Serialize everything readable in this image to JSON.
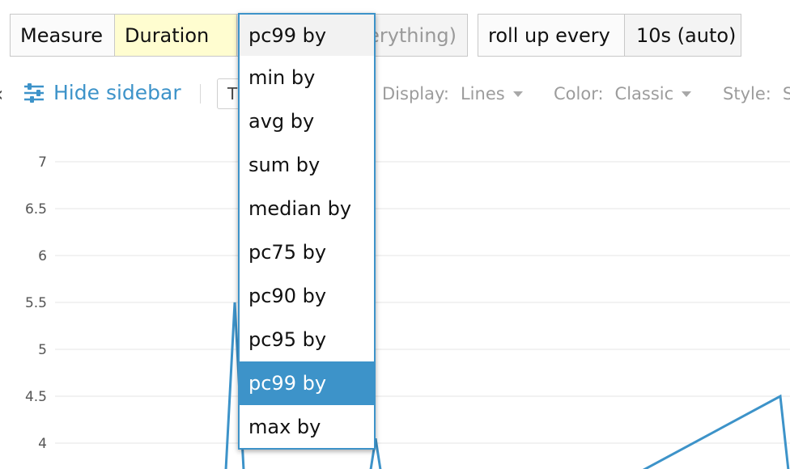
{
  "query": {
    "measure_label": "Measure",
    "metric": "Duration",
    "aggregation": "pc99 by",
    "group_by_placeholder": "erything)"
  },
  "rollup": {
    "label": "roll up every",
    "value": "10s (auto)"
  },
  "toolbar": {
    "hide_sidebar": "Hide sidebar",
    "input_text": "T",
    "display_label": "Display:",
    "display_value": "Lines",
    "color_label": "Color:",
    "color_value": "Classic",
    "style_label": "Style:",
    "style_value": "S"
  },
  "dropdown": {
    "current": "pc99 by",
    "options": [
      "min by",
      "avg by",
      "sum by",
      "median by",
      "pc75 by",
      "pc90 by",
      "pc95 by",
      "pc99 by",
      "max by"
    ],
    "selected_index": 7
  },
  "colors": {
    "accent": "#3d93c9",
    "metric_highlight": "#fffdd0",
    "series": "#3d93c9"
  },
  "chart_data": {
    "type": "line",
    "ylim": [
      3.8,
      7.2
    ],
    "yticks": [
      "7",
      "6.5",
      "6",
      "5.5",
      "5",
      "4.5",
      "4"
    ],
    "grid": true,
    "series": [
      {
        "values": [
          [
            0,
            3.55
          ],
          [
            1,
            3.55
          ],
          [
            2,
            5.5
          ],
          [
            3,
            3.55
          ],
          [
            4,
            3.55
          ],
          [
            5,
            3.55
          ],
          [
            6,
            4.05
          ],
          [
            7,
            3.55
          ],
          [
            8,
            3.55
          ],
          [
            9,
            3.55
          ],
          [
            10,
            4.5
          ],
          [
            11,
            3.55
          ]
        ]
      }
    ]
  }
}
